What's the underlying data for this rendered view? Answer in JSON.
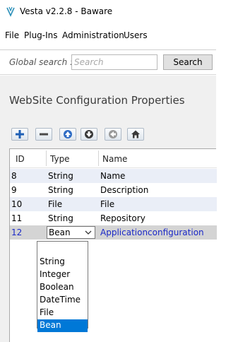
{
  "window": {
    "title": "Vesta v2.2.8 - Baware"
  },
  "menu": {
    "items": [
      "File",
      "Plug-Ins",
      "Administration",
      "Users"
    ]
  },
  "search": {
    "label": "Global search :",
    "placeholder": "Search",
    "button": "Search"
  },
  "panel": {
    "title": "WebSite Configuration Properties",
    "toolbar": [
      "add-icon",
      "remove-icon",
      "move-up-icon",
      "move-down-icon",
      "back-icon",
      "home-icon"
    ]
  },
  "grid": {
    "columns": [
      "ID",
      "Type",
      "Name"
    ],
    "rows": [
      {
        "id": "8",
        "type": "String",
        "name": "Name"
      },
      {
        "id": "9",
        "type": "String",
        "name": "Description"
      },
      {
        "id": "10",
        "type": "File",
        "name": "File"
      },
      {
        "id": "11",
        "type": "String",
        "name": "Repository"
      },
      {
        "id": "12",
        "type": "Bean",
        "name": "Applicationconfiguration"
      }
    ],
    "selected_row": 4
  },
  "dropdown": {
    "options": [
      "",
      "String",
      "Integer",
      "Boolean",
      "DateTime",
      "File",
      "Bean"
    ],
    "selected": "Bean"
  },
  "colors": {
    "accent": "#0078d7",
    "selected_text": "#1a28c7",
    "alt_row": "#eaeef7",
    "panel_bg": "#f0f0f0"
  }
}
